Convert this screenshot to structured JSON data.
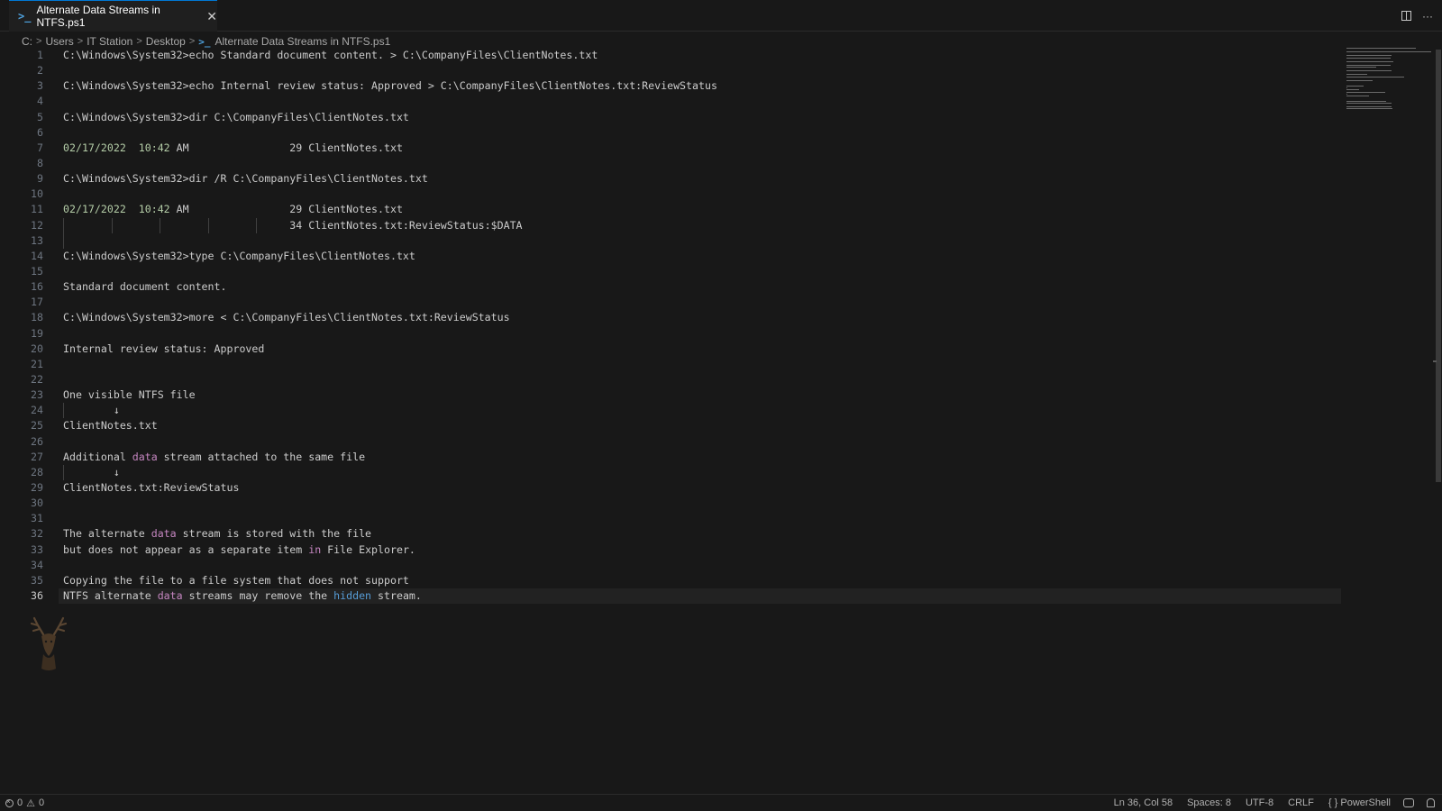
{
  "tab": {
    "label": "Alternate Data Streams in NTFS.ps1",
    "icon": "powershell-icon",
    "close_glyph": "✕"
  },
  "tab_actions": {
    "split_icon": "split-editor-icon",
    "more_label": "···"
  },
  "breadcrumb": [
    "C:",
    "Users",
    "IT Station",
    "Desktop",
    "Alternate Data Streams in NTFS.ps1"
  ],
  "colors": {
    "accent": "#0078d4",
    "keyword_pink": "#c586c0",
    "keyword_blue": "#569cd6",
    "date_green": "#b5cea8",
    "editor_bg": "#181818"
  },
  "lines": [
    {
      "n": "1",
      "text": "C:\\Windows\\System32>echo Standard document content. > C:\\CompanyFiles\\ClientNotes.txt"
    },
    {
      "n": "2",
      "text": ""
    },
    {
      "n": "3",
      "text": "C:\\Windows\\System32>echo Internal review status: Approved > C:\\CompanyFiles\\ClientNotes.txt:ReviewStatus"
    },
    {
      "n": "4",
      "text": ""
    },
    {
      "n": "5",
      "text": "C:\\Windows\\System32>dir C:\\CompanyFiles\\ClientNotes.txt"
    },
    {
      "n": "6",
      "text": ""
    },
    {
      "n": "7",
      "date": "02/17/2022  10:42",
      "rest": " AM                29 ClientNotes.txt"
    },
    {
      "n": "8",
      "text": ""
    },
    {
      "n": "9",
      "text": "C:\\Windows\\System32>dir /R C:\\CompanyFiles\\ClientNotes.txt"
    },
    {
      "n": "10",
      "text": ""
    },
    {
      "n": "11",
      "date": "02/17/2022  10:42",
      "rest": " AM                29 ClientNotes.txt"
    },
    {
      "n": "12",
      "text": "                                    34 ClientNotes.txt:ReviewStatus:$DATA",
      "guides": 5
    },
    {
      "n": "13",
      "text": "",
      "guides": 1
    },
    {
      "n": "14",
      "text": "C:\\Windows\\System32>type C:\\CompanyFiles\\ClientNotes.txt"
    },
    {
      "n": "15",
      "text": ""
    },
    {
      "n": "16",
      "text": "Standard document content."
    },
    {
      "n": "17",
      "text": ""
    },
    {
      "n": "18",
      "text": "C:\\Windows\\System32>more < C:\\CompanyFiles\\ClientNotes.txt:ReviewStatus"
    },
    {
      "n": "19",
      "text": ""
    },
    {
      "n": "20",
      "text": "Internal review status: Approved"
    },
    {
      "n": "21",
      "text": ""
    },
    {
      "n": "22",
      "text": ""
    },
    {
      "n": "23",
      "text": "One visible NTFS file"
    },
    {
      "n": "24",
      "text": "        ↓",
      "guides": 1
    },
    {
      "n": "25",
      "text": "ClientNotes.txt"
    },
    {
      "n": "26",
      "text": ""
    },
    {
      "n": "27",
      "pre": "Additional ",
      "kw": "data",
      "kwc": "pink",
      "post": " stream attached to the same file"
    },
    {
      "n": "28",
      "text": "        ↓",
      "guides": 1
    },
    {
      "n": "29",
      "text": "ClientNotes.txt:ReviewStatus"
    },
    {
      "n": "30",
      "text": ""
    },
    {
      "n": "31",
      "text": ""
    },
    {
      "n": "32",
      "pre": "The alternate ",
      "kw": "data",
      "kwc": "pink",
      "post": " stream is stored with the file"
    },
    {
      "n": "33",
      "pre": "but does not appear as a separate item ",
      "kw": "in",
      "kwc": "pink",
      "post": " File Explorer."
    },
    {
      "n": "34",
      "text": ""
    },
    {
      "n": "35",
      "text": "Copying the file to a file system that does not support"
    },
    {
      "n": "36",
      "pre": "NTFS alternate ",
      "kw": "data",
      "kwc": "pink",
      "mid": " streams may remove the ",
      "kw2": "hidden",
      "kw2c": "blue",
      "post": " stream.",
      "current": true
    }
  ],
  "watermark_icon": "deer-logo-icon",
  "status": {
    "errors": "0",
    "warnings": "0",
    "position": "Ln 36, Col 58",
    "spaces": "Spaces: 8",
    "encoding": "UTF-8",
    "eol": "CRLF",
    "language": "PowerShell",
    "language_icon": "{ }"
  }
}
